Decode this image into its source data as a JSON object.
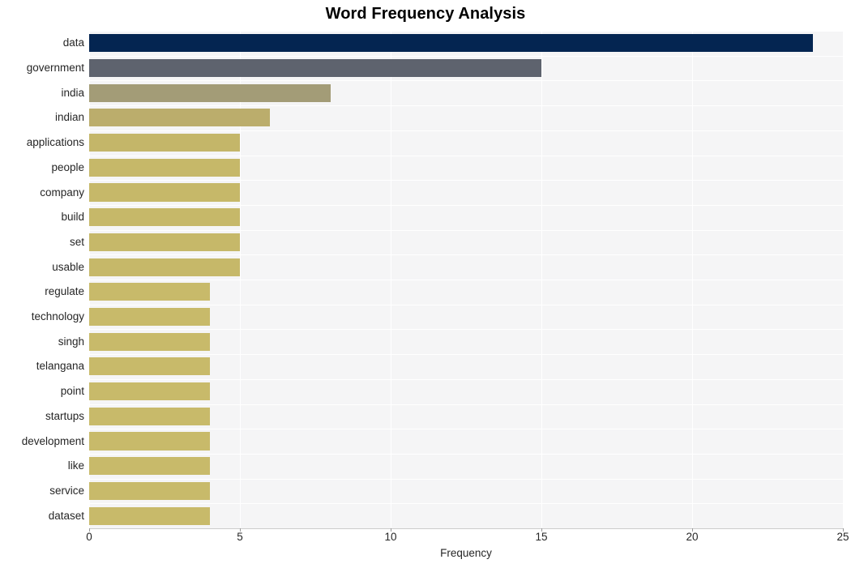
{
  "chart_data": {
    "type": "bar",
    "orientation": "horizontal",
    "title": "Word Frequency Analysis",
    "xlabel": "Frequency",
    "ylabel": "",
    "xlim": [
      0,
      25
    ],
    "xticks": [
      0,
      5,
      10,
      15,
      20,
      25
    ],
    "xtick_labels": [
      "0",
      "5",
      "10",
      "15",
      "20",
      "25"
    ],
    "grid": true,
    "grid_axis": "both",
    "legend": null,
    "categories": [
      "data",
      "government",
      "india",
      "indian",
      "applications",
      "people",
      "company",
      "build",
      "set",
      "usable",
      "regulate",
      "technology",
      "singh",
      "telangana",
      "point",
      "startups",
      "development",
      "like",
      "service",
      "dataset"
    ],
    "values": [
      24,
      15,
      8,
      6,
      5,
      5,
      5,
      5,
      5,
      5,
      4,
      4,
      4,
      4,
      4,
      4,
      4,
      4,
      4,
      4
    ],
    "bar_colors": [
      "#042551",
      "#5e636e",
      "#a39c77",
      "#bbad6c",
      "#c4b669",
      "#c6b869",
      "#c6b869",
      "#c6b869",
      "#c6b869",
      "#c6b869",
      "#c8ba6a",
      "#c8ba6a",
      "#c8ba6a",
      "#c8ba6a",
      "#c8ba6a",
      "#c8ba6a",
      "#c8ba6a",
      "#c8ba6a",
      "#c8ba6a",
      "#c8ba6a"
    ]
  },
  "style": {
    "figure_background": "#ffffff",
    "plot_background": "#f5f5f6",
    "gridline_color": "#ffffff",
    "axis_line_color": "#cccccc",
    "text_color": "#262626",
    "title_color": "#000000"
  }
}
